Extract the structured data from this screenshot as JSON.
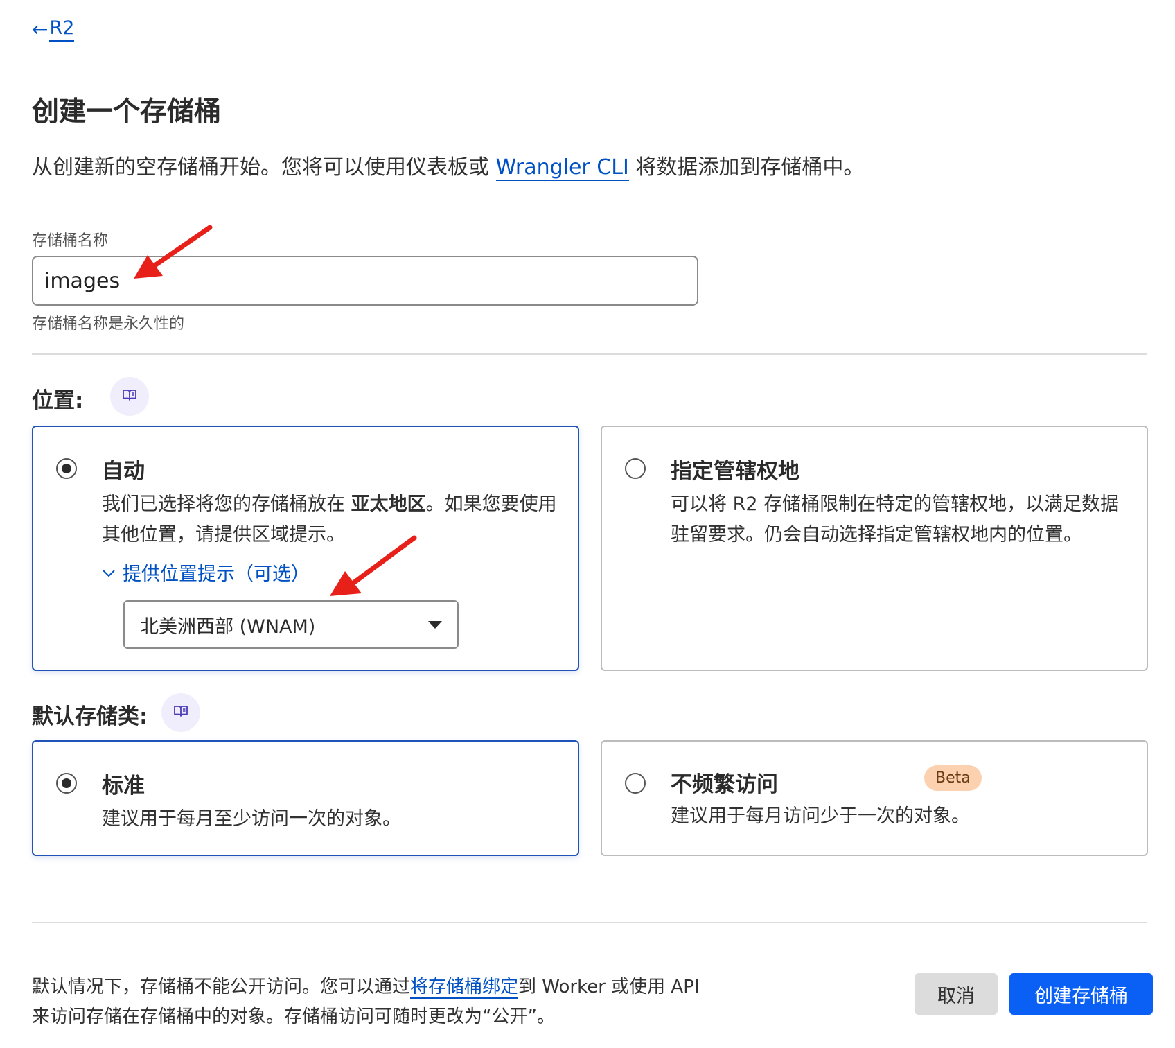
{
  "nav": {
    "back_arrow": "←",
    "back_label": "R2"
  },
  "page": {
    "title": "创建一个存储桶",
    "intro_before": "从创建新的空存储桶开始。您将可以使用仪表板或 ",
    "intro_link": "Wrangler CLI",
    "intro_after": " 将数据添加到存储桶中。"
  },
  "bucket_name": {
    "label": "存储桶名称",
    "value": "images",
    "help": "存储桶名称是永久性的"
  },
  "location": {
    "title": "位置:",
    "doc_icon": "book-icon",
    "auto": {
      "title": "自动",
      "desc_before": "我们已选择将您的存储桶放在 ",
      "desc_bold": "亚太地区",
      "desc_after": "。如果您要使用其他位置，请提供区域提示。",
      "hint_toggle": "提供位置提示（可选）",
      "hint_selected": "北美洲西部 (WNAM)",
      "selected": true
    },
    "jurisdiction": {
      "title": "指定管辖权地",
      "desc": "可以将 R2 存储桶限制在特定的管辖权地，以满足数据驻留要求。仍会自动选择指定管辖权地内的位置。",
      "selected": false
    }
  },
  "storage_class": {
    "title": "默认存储类:",
    "doc_icon": "book-icon",
    "standard": {
      "title": "标准",
      "desc": "建议用于每月至少访问一次的对象。",
      "selected": true
    },
    "infrequent": {
      "title": "不频繁访问",
      "badge": "Beta",
      "desc": "建议用于每月访问少于一次的对象。",
      "selected": false
    }
  },
  "footer": {
    "note_before": "默认情况下，存储桶不能公开访问。您可以通过",
    "note_link": "将存储桶绑定",
    "note_after_line1": "到 Worker 或使用 API",
    "note_line2": "来访问存储在存储桶中的对象。存储桶访问可随时更改为“公开”。",
    "cancel_label": "取消",
    "create_label": "创建存储桶"
  },
  "colors": {
    "link": "#0051c3",
    "primary_button": "#0a60f5",
    "selected_border": "#1f54b6",
    "annotation_arrow": "#e8201a",
    "beta_badge": "#fbd1b0"
  }
}
